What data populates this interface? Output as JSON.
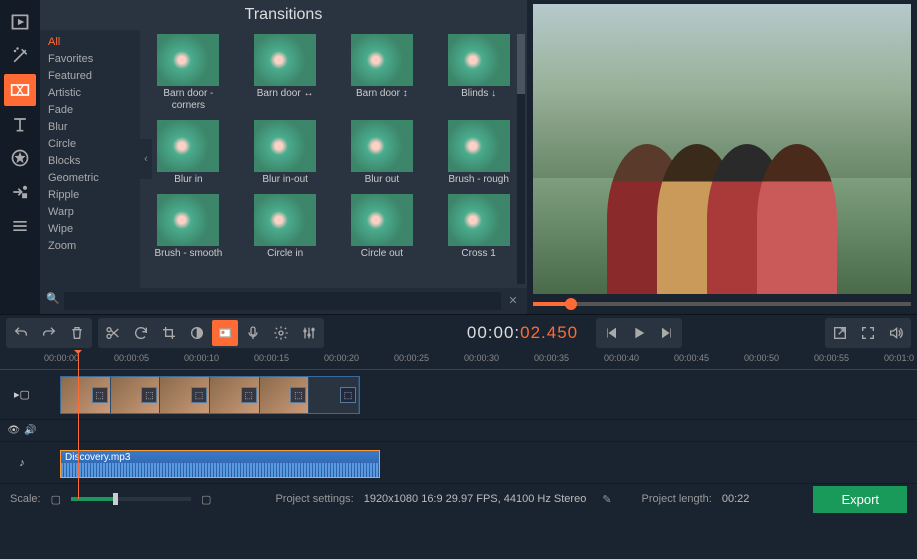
{
  "sidebar_tools": [
    "media",
    "effects",
    "transitions",
    "titles",
    "stickers",
    "callouts",
    "more"
  ],
  "panel_title": "Transitions",
  "categories": [
    "All",
    "Favorites",
    "Featured",
    "Artistic",
    "Fade",
    "Blur",
    "Circle",
    "Blocks",
    "Geometric",
    "Ripple",
    "Warp",
    "Wipe",
    "Zoom"
  ],
  "active_category": "All",
  "transitions": [
    {
      "label": "Barn door - corners"
    },
    {
      "label": "Barn door ↔"
    },
    {
      "label": "Barn door ↕"
    },
    {
      "label": "Blinds ↓"
    },
    {
      "label": "Blur in"
    },
    {
      "label": "Blur in-out"
    },
    {
      "label": "Blur out"
    },
    {
      "label": "Brush - rough"
    },
    {
      "label": "Brush - smooth"
    },
    {
      "label": "Circle in"
    },
    {
      "label": "Circle out"
    },
    {
      "label": "Cross 1"
    }
  ],
  "search_placeholder": "",
  "timecode_white": "00:00:",
  "timecode_orange": "02.450",
  "ruler_marks": [
    "00:00:00",
    "00:00:05",
    "00:00:10",
    "00:00:15",
    "00:00:20",
    "00:00:25",
    "00:00:30",
    "00:00:35",
    "00:00:40",
    "00:00:45",
    "00:00:50",
    "00:00:55",
    "00:01:0"
  ],
  "audio_clip_name": "Discovery.mp3",
  "scale_label": "Scale:",
  "project_settings_label": "Project settings:",
  "project_settings_value": "1920x1080 16:9 29.97 FPS, 44100 Hz Stereo",
  "project_length_label": "Project length:",
  "project_length_value": "00:22",
  "export_label": "Export"
}
